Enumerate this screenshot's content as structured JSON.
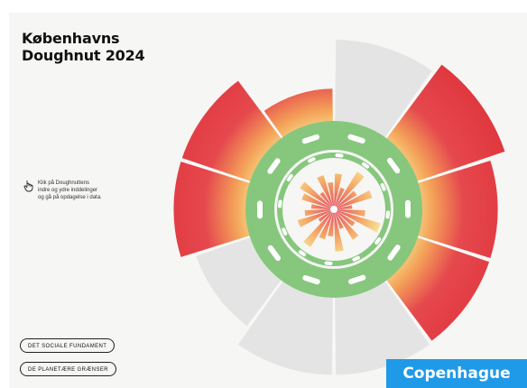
{
  "title": "Københavns\nDoughnut 2024",
  "hint": {
    "text": "Klik på Doughnuttens\nindre og ydre inddelinger\nog gå på opdagelse i data.",
    "icon": "hand-pointer-icon"
  },
  "buttons": {
    "social": "DET SOCIALE FUNDAMENT",
    "planetary": "DE PLANETÆRE GRÆNSER"
  },
  "badge": "Copenhague",
  "colors": {
    "doughnut": "#86c77d",
    "overshoot_high": "#e5484d",
    "overshoot_mid": "#f4a259",
    "overshoot_low": "#f6e58d",
    "no_data": "#e4e4e4",
    "shortfall": "#e5484d"
  },
  "chart_data": {
    "type": "doughnut",
    "outer_segments": [
      {
        "overshoot": 0.0,
        "no_data": true,
        "no_data_extent": 1.0
      },
      {
        "overshoot": 1.0,
        "no_data": false
      },
      {
        "overshoot": 0.82,
        "no_data": false
      },
      {
        "overshoot": 0.82,
        "no_data": false
      },
      {
        "overshoot": 0.0,
        "no_data": true,
        "no_data_extent": 0.95
      },
      {
        "overshoot": 0.0,
        "no_data": true,
        "no_data_extent": 0.95
      },
      {
        "overshoot": 0.0,
        "no_data": true,
        "no_data_extent": 0.7
      },
      {
        "overshoot": 0.78,
        "no_data": false
      },
      {
        "overshoot": 0.78,
        "no_data": false
      },
      {
        "overshoot": 0.35,
        "no_data": false
      }
    ],
    "inner_wedges": [
      0.7,
      0.4,
      0.9,
      0.5,
      0.8,
      0.3,
      0.6,
      1.0,
      0.45,
      0.7,
      0.35,
      0.85,
      0.5,
      0.6,
      0.9,
      0.3,
      0.75,
      0.55,
      0.4,
      0.65,
      0.8,
      0.35,
      0.7,
      0.5
    ]
  }
}
